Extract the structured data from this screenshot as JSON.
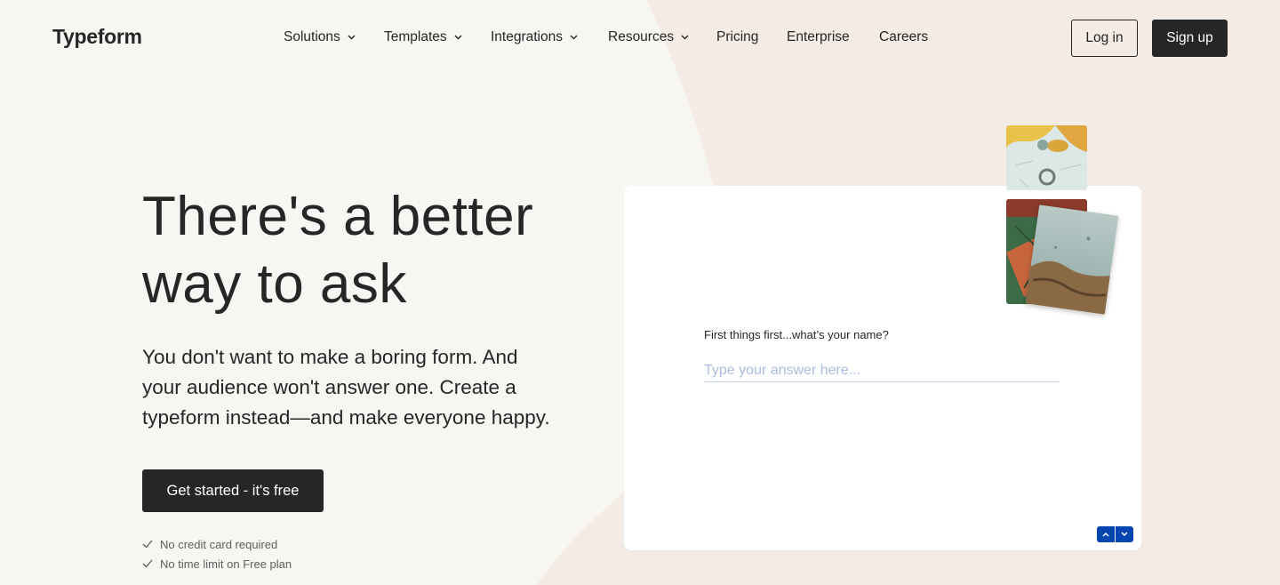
{
  "brand": {
    "logo_text": "Typeform"
  },
  "nav": {
    "items": [
      {
        "label": "Solutions",
        "has_dropdown": true
      },
      {
        "label": "Templates",
        "has_dropdown": true
      },
      {
        "label": "Integrations",
        "has_dropdown": true
      },
      {
        "label": "Resources",
        "has_dropdown": true
      },
      {
        "label": "Pricing",
        "has_dropdown": false
      },
      {
        "label": "Enterprise",
        "has_dropdown": false
      },
      {
        "label": "Careers",
        "has_dropdown": false
      }
    ],
    "login_label": "Log in",
    "signup_label": "Sign up"
  },
  "hero": {
    "title_line1": "There's a better",
    "title_line2": "way to ask",
    "subtitle_line1": "You don't want to make a boring form. And",
    "subtitle_line2": "your audience won't answer one. Create a",
    "subtitle_line3": "typeform instead—and make everyone happy.",
    "cta_label": "Get started - it's free",
    "perks": [
      "No credit card required",
      "No time limit on Free plan"
    ]
  },
  "form_preview": {
    "question": "First things first...what’s your name?",
    "answer_placeholder": "Type your answer here...",
    "accent_color": "#0445af"
  },
  "colors": {
    "background": "#f8f6f2",
    "shape": "#f3ebe4",
    "dark": "#262627"
  }
}
